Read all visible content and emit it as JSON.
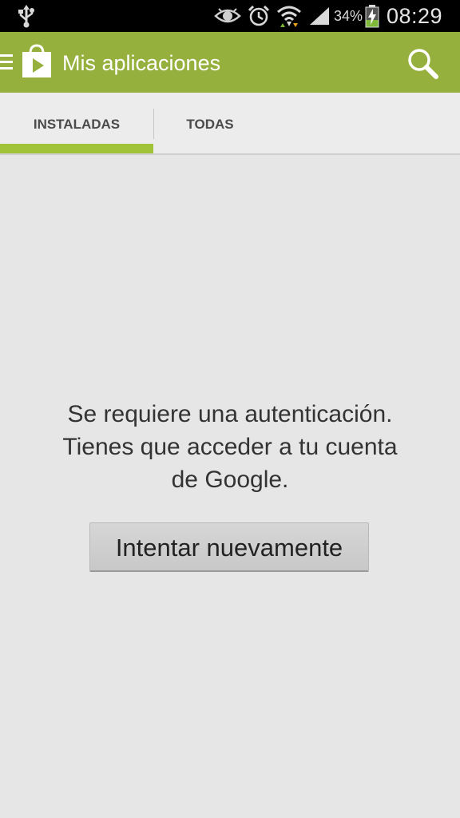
{
  "status_bar": {
    "battery_percent": "34%",
    "time": "08:29",
    "icons": [
      "usb-icon",
      "eye-icon",
      "alarm-icon",
      "wifi-icon",
      "signal-icon",
      "battery-charging-icon"
    ]
  },
  "app_bar": {
    "title": "Mis aplicaciones",
    "background_color": "#96b03e",
    "icons": [
      "menu-icon",
      "play-store-icon",
      "search-icon"
    ]
  },
  "tabs": [
    {
      "label": "INSTALADAS",
      "selected": true
    },
    {
      "label": "TODAS",
      "selected": false
    }
  ],
  "tab_indicator_color": "#a0c338",
  "message": {
    "line1": "Se requiere una autenticación.",
    "line2": "Tienes que acceder a tu cuenta",
    "line3": "de Google."
  },
  "retry_button": {
    "label": "Intentar nuevamente"
  }
}
